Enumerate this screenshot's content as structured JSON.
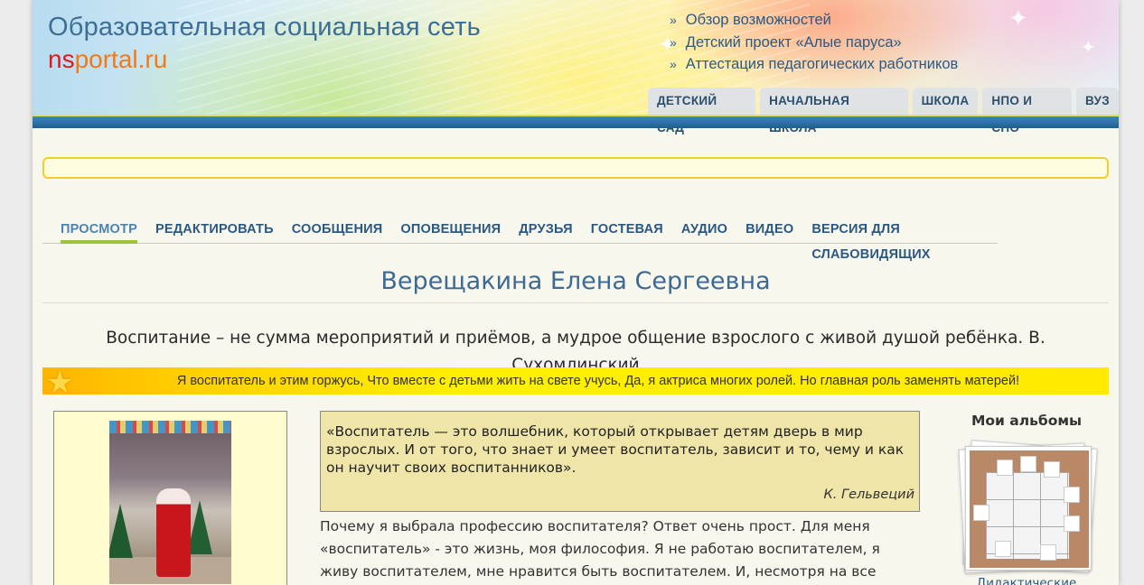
{
  "header": {
    "site_title": "Образовательная социальная сеть",
    "logo_ns": "ns",
    "logo_rest": "portal.ru",
    "top_links": [
      "Обзор возможностей",
      "Детский проект «Алые паруса»",
      "Аттестация педагогических работников"
    ],
    "edu_tabs": [
      "ДЕТСКИЙ САД",
      "НАЧАЛЬНАЯ ШКОЛА",
      "ШКОЛА",
      "НПО И СПО",
      "ВУЗ"
    ]
  },
  "nav": {
    "items": [
      "ПРОСМОТР",
      "РЕДАКТИРОВАТЬ",
      "СООБЩЕНИЯ",
      "ОПОВЕЩЕНИЯ",
      "ДРУЗЬЯ",
      "ГОСТЕВАЯ",
      "АУДИО",
      "ВИДЕО",
      "ВЕРСИЯ ДЛЯ СЛАБОВИДЯЩИХ"
    ],
    "active": "ПРОСМОТР"
  },
  "profile": {
    "name": "Верещакина Елена Сергеевна",
    "motto": "Воспитание – не сумма мероприятий и приёмов, а мудрое общение взрослого с живой душой ребёнка. В. Сухомлинский",
    "banner": "Я воспитатель и этим горжусь, Что вместе с детьми жить на свете учусь, Да, я актриса многих ролей. Но главная роль заменять матерей!"
  },
  "quote": {
    "text": "«Воспитатель — это волшебник, который открывает детям дверь в мир взрослых. И от того, что знает и умеет воспитатель, зависит и то, чему и как он научит своих воспитанников».",
    "author": "К. Гельвеций"
  },
  "body_text": "Почему я выбрала профессию воспитателя? Ответ очень прост. Для меня «воспитатель» - это жизнь, моя философия. Я не работаю воспитателем, я живу воспитателем, мне нравится быть воспитателем. И, несмотря на все трудности и",
  "albums": {
    "title": "Мои альбомы",
    "caption": "Дидактические"
  },
  "colors": {
    "header_blue": "#3d6e96",
    "logo_red": "#e21818",
    "logo_orange": "#f07a1a",
    "nav_blue": "#2b587f",
    "active_underline": "#9dc23b",
    "banner_yellow": "#fff000",
    "quote_bg": "#efe5a8"
  }
}
